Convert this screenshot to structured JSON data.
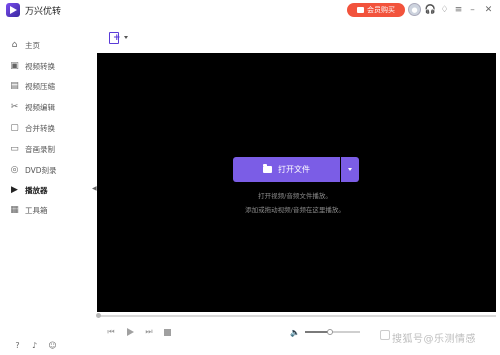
{
  "app": {
    "name": "万兴优转",
    "vip_label": "会员购买"
  },
  "sidebar": {
    "items": [
      {
        "label": "主页",
        "icon": "home-icon"
      },
      {
        "label": "视频转换",
        "icon": "convert-icon"
      },
      {
        "label": "视频压缩",
        "icon": "compress-icon"
      },
      {
        "label": "视频编辑",
        "icon": "scissors-icon"
      },
      {
        "label": "合并转换",
        "icon": "merge-icon"
      },
      {
        "label": "音画录制",
        "icon": "record-icon"
      },
      {
        "label": "DVD刻录",
        "icon": "disc-icon"
      },
      {
        "label": "播放器",
        "icon": "player-icon"
      },
      {
        "label": "工具箱",
        "icon": "toolbox-icon"
      }
    ],
    "active_index": 7
  },
  "player": {
    "open_button_label": "打开文件",
    "hint_line1": "打开视频/音频文件播放。",
    "hint_line2": "添加或拖动视频/音频在这里播放。"
  },
  "controls": {
    "volume_level": 0.45,
    "progress": 0.0
  },
  "watermark": "搜狐号@乐测情感"
}
